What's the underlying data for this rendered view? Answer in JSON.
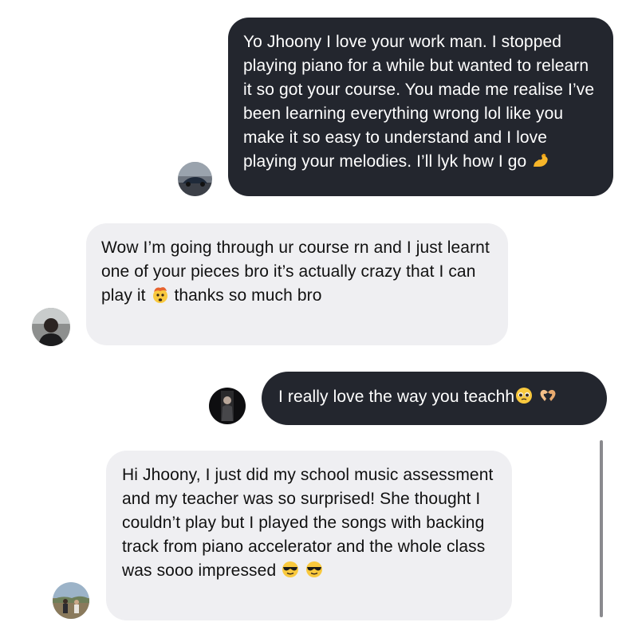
{
  "messages": [
    {
      "id": "m1",
      "direction": "outgoing",
      "text_main": "Yo Jhoony I love your work man. I stopped playing piano for a while but wanted to relearn it so got your course. You made me realise I’ve been learning everything wrong lol like you make it so easy to understand and I love playing your melodies. I’ll lyk how I go",
      "emoji_end": "flexed-biceps"
    },
    {
      "id": "m2",
      "direction": "incoming",
      "text_before_emoji": "Wow I’m going through ur course rn and I just learnt one of your pieces bro it’s actually crazy that I can play it",
      "emoji_mid": "exploding-head",
      "text_after_emoji": "thanks so much bro"
    },
    {
      "id": "m3",
      "direction": "outgoing",
      "text_main": "I really love the way you teachh",
      "emojis_end": [
        "pleading-face",
        "heart-hands"
      ]
    },
    {
      "id": "m4",
      "direction": "incoming",
      "text_main": "Hi Jhoony, I just did my school music assessment and my teacher was so surprised! She thought I couldn’t play but I played the songs with backing track from piano accelerator and the whole class was sooo impressed",
      "emojis_end": [
        "sunglasses-face",
        "sunglasses-face"
      ]
    }
  ],
  "colors": {
    "outgoing_bubble": "#23262e",
    "incoming_bubble": "#efeff2",
    "outgoing_text": "#ffffff",
    "incoming_text": "#111111"
  }
}
